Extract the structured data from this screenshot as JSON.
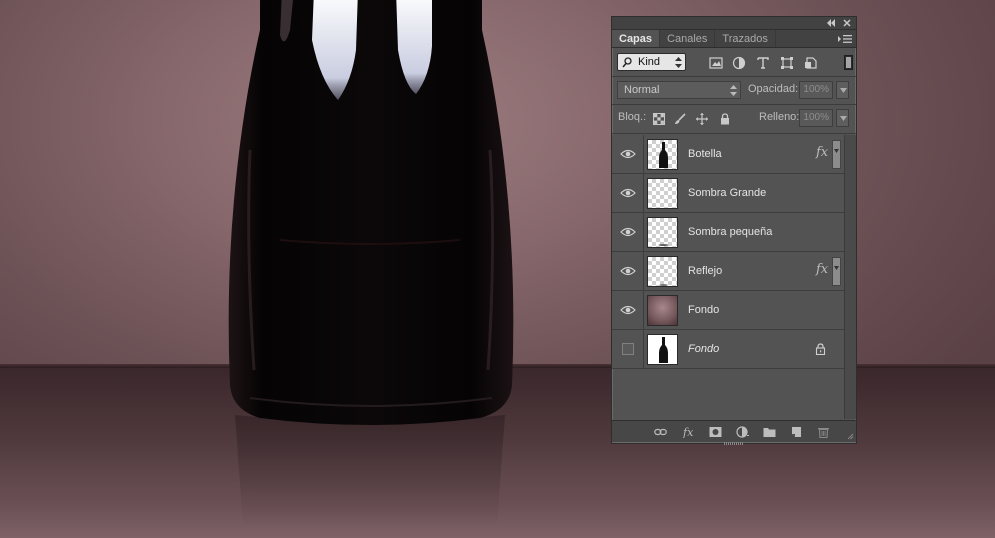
{
  "panel": {
    "tabs": [
      {
        "label": "Capas",
        "active": true
      },
      {
        "label": "Canales",
        "active": false
      },
      {
        "label": "Trazados",
        "active": false
      }
    ],
    "filter": {
      "kind_label": "Kind"
    },
    "blend": {
      "mode": "Normal",
      "opacity_label": "Opacidad:",
      "opacity_value": "100%"
    },
    "lock": {
      "lock_label": "Bloq.:",
      "fill_label": "Relleno:",
      "fill_value": "100%"
    },
    "layers": [
      {
        "name": "Botella",
        "visible": true,
        "thumb": "bottle-transparent",
        "fx": "fx"
      },
      {
        "name": "Sombra Grande",
        "visible": true,
        "thumb": "transparent"
      },
      {
        "name": "Sombra pequeña",
        "visible": true,
        "thumb": "transparent-shadow"
      },
      {
        "name": "Reflejo",
        "visible": true,
        "thumb": "transparent-shadow",
        "fx": "fx"
      },
      {
        "name": "Fondo",
        "visible": true,
        "thumb": "gradient"
      },
      {
        "name": "Fondo",
        "visible": false,
        "thumb": "bottle-white",
        "italic": true,
        "locked": true
      }
    ]
  },
  "colors": {
    "panel_bg": "#535353",
    "wall": "#86676b",
    "floor": "#4e383c",
    "bottle": "#0b0708"
  }
}
